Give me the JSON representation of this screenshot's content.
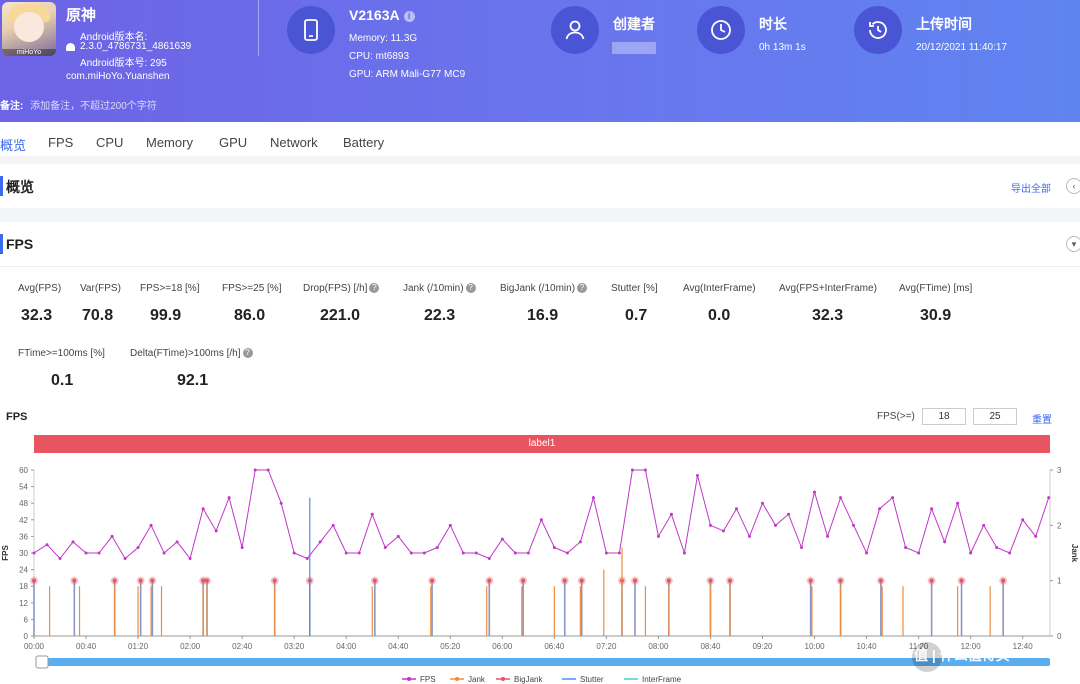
{
  "header": {
    "app_name": "原神",
    "app_icon_tag": "miHoYo",
    "android_version_label": "Android版本名:",
    "android_version_value": "2.3.0_4786731_4861639",
    "android_code": "Android版本号: 295",
    "package": "com.miHoYo.Yuanshen",
    "device_name": "V2163A",
    "info_icon_glyph": "i",
    "memory": "Memory: 11.3G",
    "cpu": "CPU: mt6893",
    "gpu": "GPU: ARM Mali-G77 MC9",
    "creator_title": "创建者",
    "duration_title": "时长",
    "duration_value": "0h 13m 1s",
    "upload_title": "上传时间",
    "upload_value": "20/12/2021 11:40:17",
    "remark_label": "备注:",
    "remark_placeholder": "添加备注，不超过200个字符"
  },
  "tabs": [
    "概览",
    "FPS",
    "CPU",
    "Memory",
    "GPU",
    "Network",
    "Battery"
  ],
  "overview": {
    "title": "概览",
    "export": "导出全部",
    "collapse_glyph": "‹"
  },
  "fps_card": {
    "title": "FPS",
    "expand_glyph": "▾",
    "help_glyph": "?",
    "stats_row1": [
      {
        "label": "Avg(FPS)",
        "value": "32.3"
      },
      {
        "label": "Var(FPS)",
        "value": "70.8"
      },
      {
        "label": "FPS>=18 [%]",
        "value": "99.9"
      },
      {
        "label": "FPS>=25 [%]",
        "value": "86.0"
      },
      {
        "label": "Drop(FPS) [/h]",
        "value": "221.0",
        "help": true
      },
      {
        "label": "Jank (/10min)",
        "value": "22.3",
        "help": true
      },
      {
        "label": "BigJank (/10min)",
        "value": "16.9",
        "help": true
      },
      {
        "label": "Stutter [%]",
        "value": "0.7"
      },
      {
        "label": "Avg(InterFrame)",
        "value": "0.0"
      },
      {
        "label": "Avg(FPS+InterFrame)",
        "value": "32.3"
      },
      {
        "label": "Avg(FTime) [ms]",
        "value": "30.9"
      }
    ],
    "stats_row2": [
      {
        "label": "FTime>=100ms [%]",
        "value": "0.1"
      },
      {
        "label": "Delta(FTime)>100ms [/h]",
        "value": "92.1",
        "help": true
      }
    ],
    "chart_caption": "FPS",
    "threshold_label": "FPS(>=)",
    "threshold_1": "18",
    "threshold_2": "25",
    "reset_label": "重置",
    "label_bar": "label1"
  },
  "watermark": "值 | 什么值得买",
  "colors": {
    "fps": "#c037c8",
    "jank": "#f08c3c",
    "bigjank": "#e8545f",
    "stutter": "#4f8ef0",
    "interframe": "#4fc8d8",
    "accent": "#3a6bf0",
    "header": "#6c63e6"
  },
  "chart_data": {
    "type": "line",
    "title": "",
    "ylabel": "FPS",
    "y2label": "Jank",
    "ylim": [
      0,
      60
    ],
    "y2lim": [
      0,
      3
    ],
    "yticks": [
      "0",
      "6",
      "12",
      "18",
      "24",
      "30",
      "36",
      "42",
      "48",
      "54",
      "60"
    ],
    "y2ticks": [
      "0",
      "1",
      "2",
      "3"
    ],
    "xticks": [
      "00:00",
      "00:40",
      "01:20",
      "02:00",
      "02:40",
      "03:20",
      "04:00",
      "04:40",
      "05:20",
      "06:00",
      "06:40",
      "07:20",
      "08:00",
      "08:40",
      "09:20",
      "10:00",
      "10:40",
      "11:20",
      "12:00",
      "12:40"
    ],
    "x_seconds_range": [
      0,
      781
    ],
    "legend": [
      "FPS",
      "Jank",
      "BigJank",
      "Stutter",
      "InterFrame"
    ],
    "legend_position": "bottom",
    "series": [
      {
        "name": "FPS",
        "x_seconds": [
          0,
          10,
          20,
          30,
          40,
          50,
          60,
          70,
          80,
          90,
          100,
          110,
          120,
          130,
          140,
          150,
          160,
          170,
          180,
          190,
          200,
          210,
          220,
          230,
          240,
          250,
          260,
          270,
          280,
          290,
          300,
          310,
          320,
          330,
          340,
          350,
          360,
          370,
          380,
          390,
          400,
          410,
          420,
          430,
          440,
          450,
          460,
          470,
          480,
          490,
          500,
          510,
          520,
          530,
          540,
          550,
          560,
          570,
          580,
          590,
          600,
          610,
          620,
          630,
          640,
          650,
          660,
          670,
          680,
          690,
          700,
          710,
          720,
          730,
          740,
          750,
          760,
          770,
          780
        ],
        "values": [
          30,
          33,
          28,
          34,
          30,
          30,
          36,
          28,
          32,
          40,
          30,
          34,
          28,
          46,
          38,
          50,
          32,
          60,
          60,
          48,
          30,
          28,
          34,
          40,
          30,
          30,
          44,
          32,
          36,
          30,
          30,
          32,
          40,
          30,
          30,
          28,
          35,
          30,
          30,
          42,
          32,
          30,
          34,
          50,
          30,
          30,
          60,
          60,
          36,
          44,
          30,
          58,
          40,
          38,
          46,
          36,
          48,
          40,
          44,
          32,
          52,
          36,
          50,
          40,
          30,
          46,
          50,
          32,
          30,
          46,
          34,
          48,
          30,
          40,
          32,
          30,
          42,
          36,
          50
        ]
      },
      {
        "name": "Jank",
        "x_seconds": [
          12,
          35,
          62,
          80,
          90,
          98,
          130,
          133,
          185,
          212,
          260,
          305,
          348,
          375,
          400,
          420,
          438,
          452,
          470,
          488,
          520,
          535,
          598,
          620,
          652,
          668,
          710,
          735
        ],
        "values": [
          0.9,
          0.9,
          0.9,
          0.9,
          0.9,
          0.9,
          0.9,
          0.9,
          0.9,
          0.9,
          0.9,
          0.9,
          0.9,
          0.9,
          0.9,
          0.9,
          1.2,
          1.6,
          0.9,
          0.9,
          0.9,
          0.9,
          0.9,
          0.9,
          0.9,
          0.9,
          0.9,
          0.9
        ]
      },
      {
        "name": "BigJank",
        "x_seconds": [
          0,
          31,
          62,
          82,
          91,
          130,
          133,
          185,
          212,
          262,
          306,
          350,
          376,
          408,
          421,
          452,
          462,
          488,
          520,
          535,
          597,
          620,
          651,
          690,
          713,
          745
        ],
        "values": [
          1,
          1,
          1,
          1,
          1,
          1,
          1,
          1,
          1,
          1,
          1,
          1,
          1,
          1,
          1,
          1,
          1,
          1,
          1,
          1,
          1,
          1,
          1,
          1,
          1,
          1
        ]
      },
      {
        "name": "Stutter",
        "x_seconds": [
          212
        ],
        "values": [
          2.5
        ]
      },
      {
        "name": "InterFrame",
        "x_seconds": [],
        "values": []
      }
    ]
  }
}
